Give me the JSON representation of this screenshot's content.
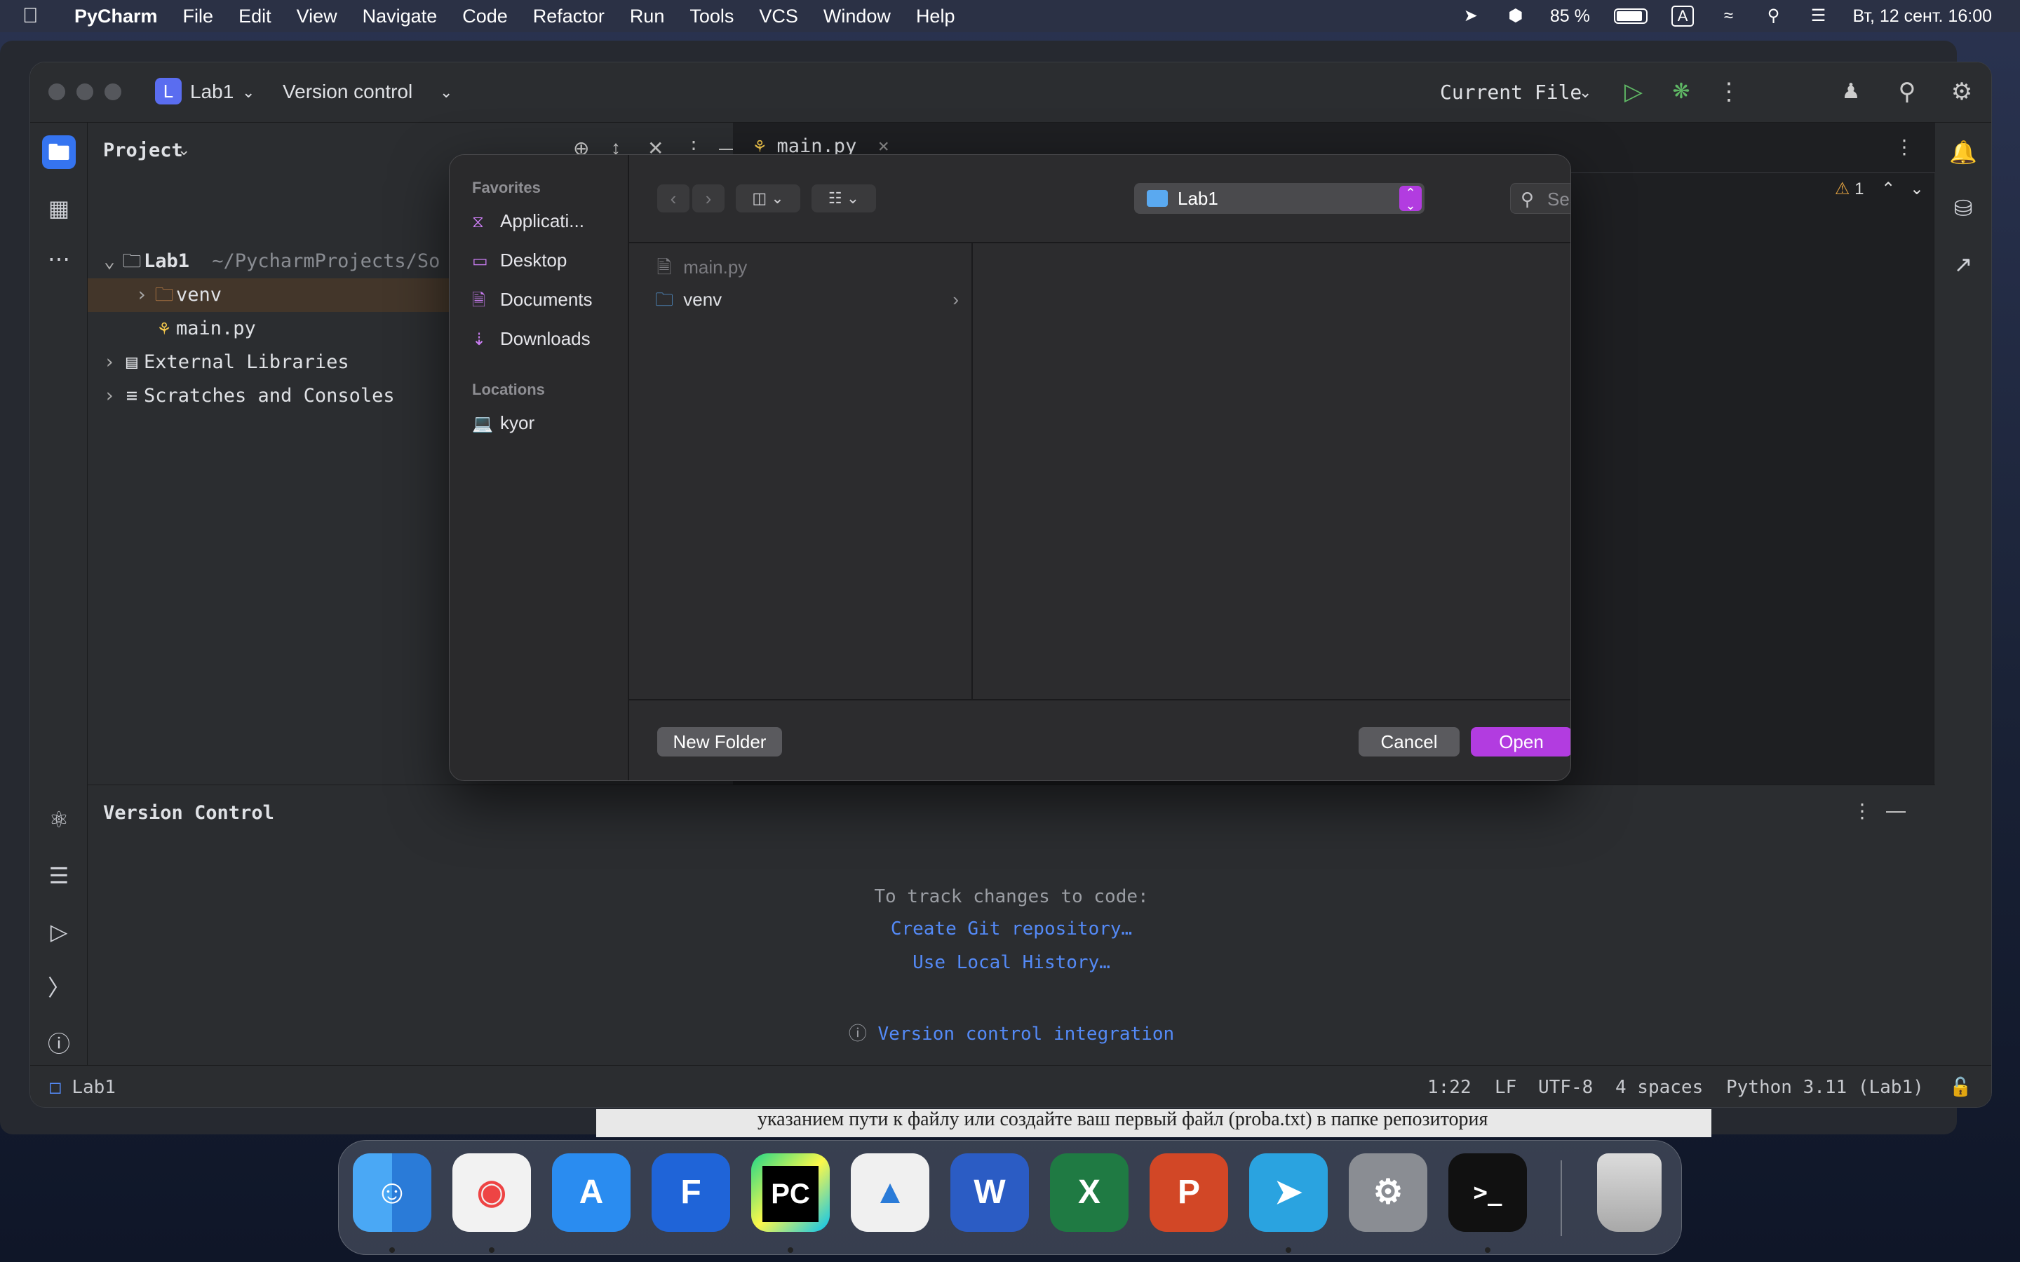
{
  "menubar": {
    "app": "PyCharm",
    "items": [
      "File",
      "Edit",
      "View",
      "Navigate",
      "Code",
      "Refactor",
      "Run",
      "Tools",
      "VCS",
      "Window",
      "Help"
    ],
    "battery": "85 %",
    "input_lang": "A",
    "datetime": "Вт, 12 сент.  16:00"
  },
  "ide": {
    "project_badge": "L",
    "project_name": "Lab1",
    "vcs_widget": "Version control",
    "run_config": "Current File",
    "project_panel": {
      "title": "Project",
      "tree": [
        {
          "label": "Lab1",
          "path": "~/PycharmProjects/So",
          "icon": "folder-icon"
        },
        {
          "label": "venv",
          "icon": "folder-icon"
        },
        {
          "label": "main.py",
          "icon": "python-file-icon"
        },
        {
          "label": "External Libraries",
          "icon": "library-icon"
        },
        {
          "label": "Scratches and Consoles",
          "icon": "scratch-icon"
        }
      ]
    },
    "editor_tab": "main.py",
    "inspection_count": "1",
    "version_control": {
      "title": "Version Control",
      "hint": "To track changes to code:",
      "create_git": "Create Git repository…",
      "local_history": "Use Local History…",
      "integration": "Version control integration"
    },
    "statusbar": {
      "project": "Lab1",
      "position": "1:22",
      "line_sep": "LF",
      "encoding": "UTF-8",
      "indent": "4 spaces",
      "interpreter": "Python 3.11 (Lab1)"
    }
  },
  "dialog": {
    "favorites_header": "Favorites",
    "favorites": [
      {
        "label": "Applicati...",
        "icon": "applications-icon"
      },
      {
        "label": "Desktop",
        "icon": "desktop-icon"
      },
      {
        "label": "Documents",
        "icon": "documents-icon"
      },
      {
        "label": "Downloads",
        "icon": "downloads-icon"
      }
    ],
    "locations_header": "Locations",
    "locations": [
      {
        "label": "kyor",
        "icon": "laptop-icon"
      }
    ],
    "current_location": "Lab1",
    "search_placeholder": "Search",
    "files": [
      {
        "name": "main.py",
        "enabled": false
      },
      {
        "name": "venv",
        "enabled": true
      }
    ],
    "new_folder": "New Folder",
    "cancel": "Cancel",
    "open": "Open"
  },
  "background_doc_text": "указанием пути к файлу или создайте ваш первый файл (proba.txt) в папке репозитория",
  "dock": [
    "finder-icon",
    "chrome-icon",
    "app-store-icon",
    "notion-icon",
    "pycharm-icon",
    "instruments-icon",
    "word-icon",
    "excel-icon",
    "powerpoint-icon",
    "telegram-icon",
    "system-settings-icon",
    "terminal-icon",
    "trash-icon"
  ],
  "colors": {
    "accent": "#3574f0",
    "dialog_primary": "#b23ce0",
    "link": "#548af7"
  }
}
